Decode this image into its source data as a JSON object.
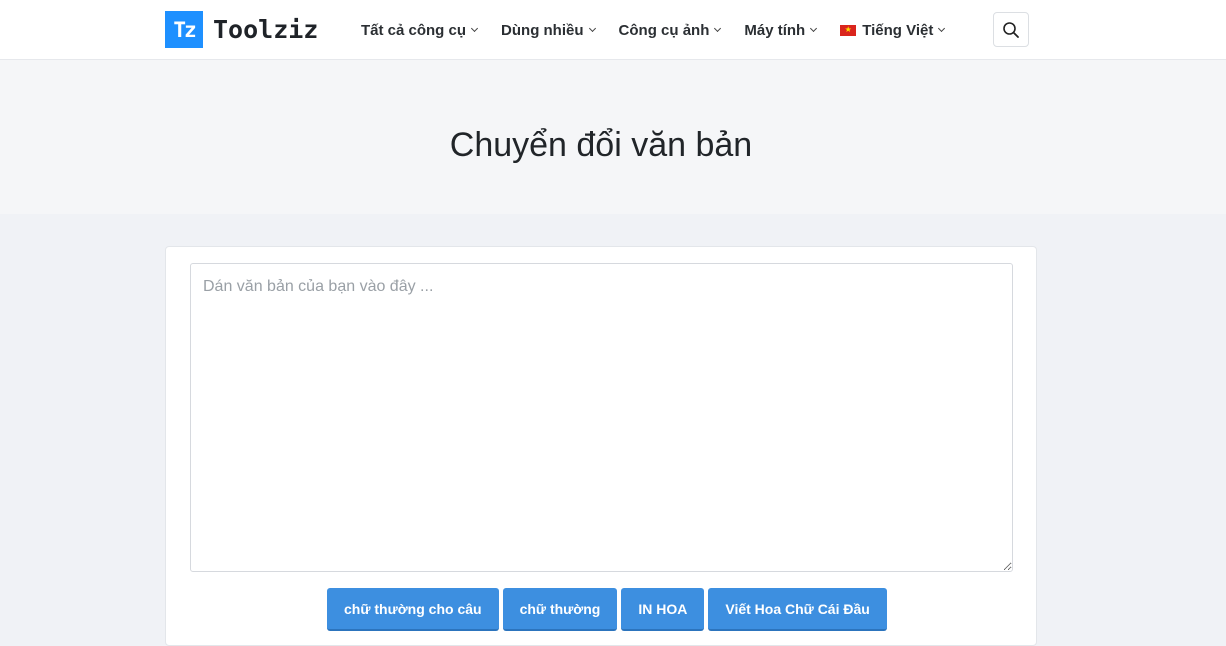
{
  "header": {
    "logo_mark": "Tz",
    "logo_text": "Toolziz",
    "nav": [
      {
        "label": "Tất cả công cụ"
      },
      {
        "label": "Dùng nhiều"
      },
      {
        "label": "Công cụ ảnh"
      },
      {
        "label": "Máy tính"
      },
      {
        "label": "Tiếng Việt"
      }
    ],
    "search_icon": "search-icon"
  },
  "hero": {
    "title": "Chuyển đổi văn bản"
  },
  "editor": {
    "placeholder": "Dán văn bản của bạn vào đây ...",
    "value": ""
  },
  "actions": {
    "sentence_case": "chữ thường cho câu",
    "lower_case": "chữ thường",
    "upper_case": "IN HOA",
    "title_case": "Viết Hoa Chữ Cái Đầu"
  },
  "colors": {
    "accent": "#3d8fe0",
    "logo": "#1e90ff",
    "flag_red": "#da251d",
    "flag_star": "#ffde00"
  }
}
